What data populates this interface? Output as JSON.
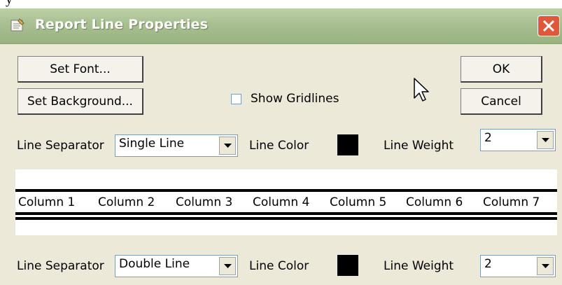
{
  "window": {
    "title": "Report Line Properties"
  },
  "buttons": {
    "set_font": "Set Font...",
    "set_background": "Set Background...",
    "ok": "OK",
    "cancel": "Cancel"
  },
  "show_gridlines": {
    "label": "Show Gridlines",
    "checked": false
  },
  "row1": {
    "separator_label": "Line Separator",
    "separator_value": "Single Line",
    "color_label": "Line Color",
    "color_value": "#000000",
    "weight_label": "Line Weight",
    "weight_value": "2"
  },
  "preview": {
    "columns": [
      "Column 1",
      "Column 2",
      "Column 3",
      "Column 4",
      "Column 5",
      "Column 6",
      "Column 7"
    ]
  },
  "row2": {
    "separator_label": "Line Separator",
    "separator_value": "Double Line",
    "color_label": "Line Color",
    "color_value": "#000000",
    "weight_label": "Line Weight",
    "weight_value": "2"
  },
  "icons": {
    "app": "notepad-icon",
    "close": "close-icon",
    "dropdown": "chevron-down-icon",
    "cursor": "mouse-pointer-icon"
  },
  "colors": {
    "titlebar": "#a9c092",
    "dialog": "#ece9d8",
    "close": "#e0583b"
  }
}
